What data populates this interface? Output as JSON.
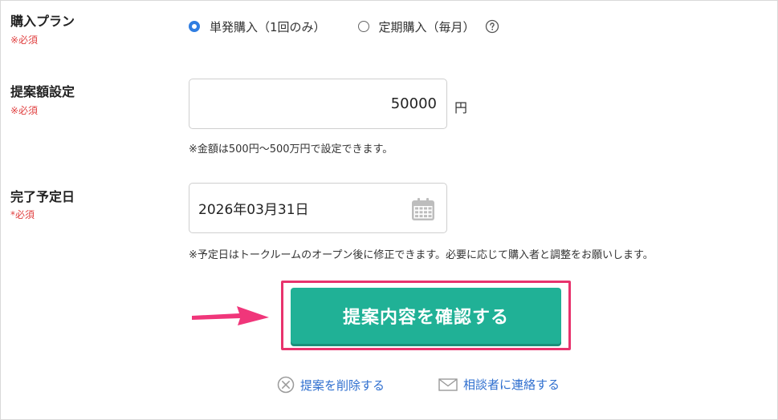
{
  "purchase_plan": {
    "label": "購入プラン",
    "required": "※必須",
    "options": [
      {
        "label": "単発購入（1回のみ）",
        "selected": true
      },
      {
        "label": "定期購入（毎月）",
        "selected": false
      }
    ],
    "help_icon": "question-circle-icon"
  },
  "amount": {
    "label": "提案額設定",
    "required": "※必須",
    "value": "50000",
    "unit": "円",
    "note": "※金額は500円〜500万円で設定できます。"
  },
  "completion_date": {
    "label": "完了予定日",
    "required": "*必須",
    "value": "2026年03月31日",
    "calendar_icon": "calendar-icon",
    "note": "※予定日はトークルームのオープン後に修正できます。必要に応じて購入者と調整をお願いします。"
  },
  "confirm_button": {
    "label": "提案内容を確認する",
    "color": "#20b196",
    "highlight_color": "#e8336d"
  },
  "links": {
    "delete": {
      "label": "提案を削除する",
      "icon": "circle-x-icon"
    },
    "contact": {
      "label": "相談者に連絡する",
      "icon": "envelope-icon"
    }
  },
  "colors": {
    "accent_blue": "#2f7de1",
    "required_red": "#e04040",
    "link_blue": "#2f6fcf",
    "arrow_pink": "#f0367a"
  }
}
